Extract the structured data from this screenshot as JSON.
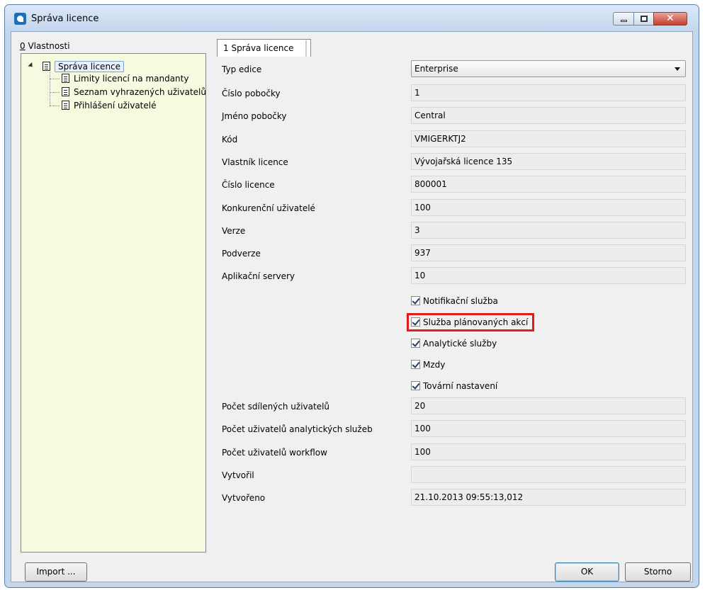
{
  "window": {
    "title": "Správa licence",
    "controls": {
      "minimize_icon": "minimize-icon",
      "maximize_icon": "maximize-icon",
      "close_icon": "close-icon"
    }
  },
  "left_panel": {
    "label_hotkey": "0",
    "label_text": " Vlastnosti",
    "tree": {
      "root": "Správa licence",
      "children": [
        "Limity licencí na mandanty",
        "Seznam vyhrazených uživatelů",
        "Přihlášení uživatelé"
      ]
    }
  },
  "tabs": [
    {
      "label": "1 Správa licence"
    }
  ],
  "form": {
    "typ_edice": {
      "label": "Typ edice",
      "value": "Enterprise"
    },
    "fields": [
      {
        "label": "Číslo pobočky",
        "value": "1"
      },
      {
        "label": "Jméno pobočky",
        "value": "Central"
      },
      {
        "label": "Kód",
        "value": "VMIGERKTJ2"
      },
      {
        "label": "Vlastník licence",
        "value": "Vývojařská licence 135"
      },
      {
        "label": "Číslo licence",
        "value": "800001"
      },
      {
        "label": "Konkurenční uživatelé",
        "value": "100"
      },
      {
        "label": "Verze",
        "value": "3"
      },
      {
        "label": "Podverze",
        "value": "937"
      },
      {
        "label": "Aplikační servery",
        "value": "10"
      }
    ],
    "checkboxes": [
      {
        "label": "Notifikační služba",
        "checked": true
      },
      {
        "label": "Služba plánovaných akcí",
        "checked": true
      },
      {
        "label": "Analytické služby",
        "checked": true
      },
      {
        "label": "Mzdy",
        "checked": true
      },
      {
        "label": "Tovární nastavení",
        "checked": true
      }
    ],
    "fields2": [
      {
        "label": "Počet sdílených uživatelů",
        "value": "20"
      },
      {
        "label": "Počet uživatelů analytických služeb",
        "value": "100"
      },
      {
        "label": "Počet uživatelů workflow",
        "value": "100"
      },
      {
        "label": "Vytvořil",
        "value": ""
      },
      {
        "label": "Vytvořeno",
        "value": "21.10.2013 09:55:13,012"
      }
    ]
  },
  "buttons": {
    "import": "Import ...",
    "ok": "OK",
    "storno": "Storno"
  },
  "colors": {
    "highlight": "#e21b1b",
    "tree_bg": "#f5fbdf",
    "title_bg": "#c4d6ec"
  }
}
